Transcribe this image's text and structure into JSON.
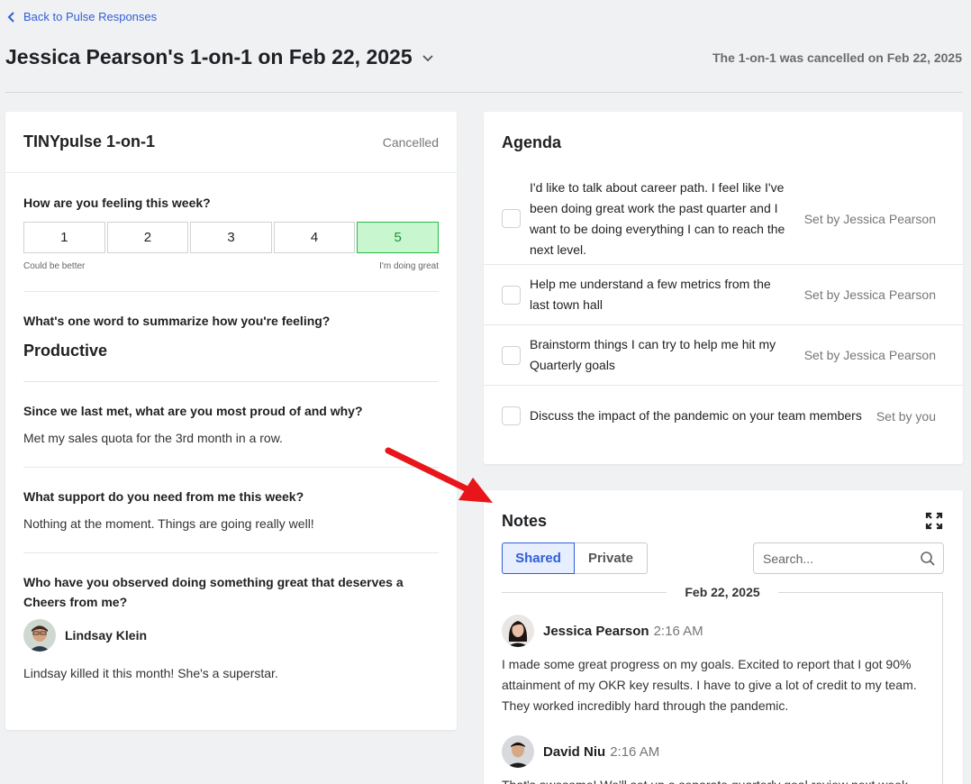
{
  "nav": {
    "back_label": "Back to Pulse Responses"
  },
  "header": {
    "title": "Jessica Pearson's 1-on-1 on Feb 22, 2025",
    "status_note": "The 1-on-1 was cancelled on Feb 22, 2025"
  },
  "one_on_one": {
    "title": "TINYpulse 1-on-1",
    "status": "Cancelled",
    "feeling": {
      "question": "How are you feeling this week?",
      "options": [
        "1",
        "2",
        "3",
        "4",
        "5"
      ],
      "selected_value": 5,
      "low_label": "Could be better",
      "high_label": "I'm doing great"
    },
    "one_word": {
      "question": "What's one word to summarize how you're feeling?",
      "answer": "Productive"
    },
    "proud": {
      "question": "Since we last met, what are you most proud of and why?",
      "answer": "Met my sales quota for the 3rd month in a row."
    },
    "support": {
      "question": "What support do you need from me this week?",
      "answer": "Nothing at the moment. Things are going really well!"
    },
    "cheers": {
      "question": "Who have you observed doing something great that deserves a Cheers from me?",
      "person": "Lindsay Klein",
      "comment": "Lindsay killed it this month! She's a superstar."
    }
  },
  "agenda": {
    "title": "Agenda",
    "items": [
      {
        "text": "I'd like to talk about career path. I feel like I've been doing great work the past quarter and I want to be doing everything I can to reach the next level.",
        "set_by": "Set by Jessica Pearson"
      },
      {
        "text": "Help me understand a few metrics from the last town hall",
        "set_by": "Set by Jessica Pearson"
      },
      {
        "text": "Brainstorm things I can try to help me hit my Quarterly goals",
        "set_by": "Set by Jessica Pearson"
      },
      {
        "text": "Discuss the impact of the pandemic on your team members",
        "set_by": "Set by you"
      }
    ]
  },
  "notes": {
    "title": "Notes",
    "tabs": [
      "Shared",
      "Private"
    ],
    "active_tab": "Shared",
    "search_placeholder": "Search...",
    "date_label": "Feb 22, 2025",
    "entries": [
      {
        "author": "Jessica Pearson",
        "time": "2:16 AM",
        "body": "I made some great progress on my goals. Excited to report that I got 90% attainment of my OKR key results. I have to give a lot of credit to my team. They worked incredibly hard through the pandemic."
      },
      {
        "author": "David Niu",
        "time": "2:16 AM",
        "body": "That's awesome! We'll set up a separate quarterly goal review next week"
      }
    ]
  },
  "colors": {
    "link": "#2f5fd7",
    "selected_green": "#c8f7cf",
    "arrow_red": "#e8161b"
  }
}
